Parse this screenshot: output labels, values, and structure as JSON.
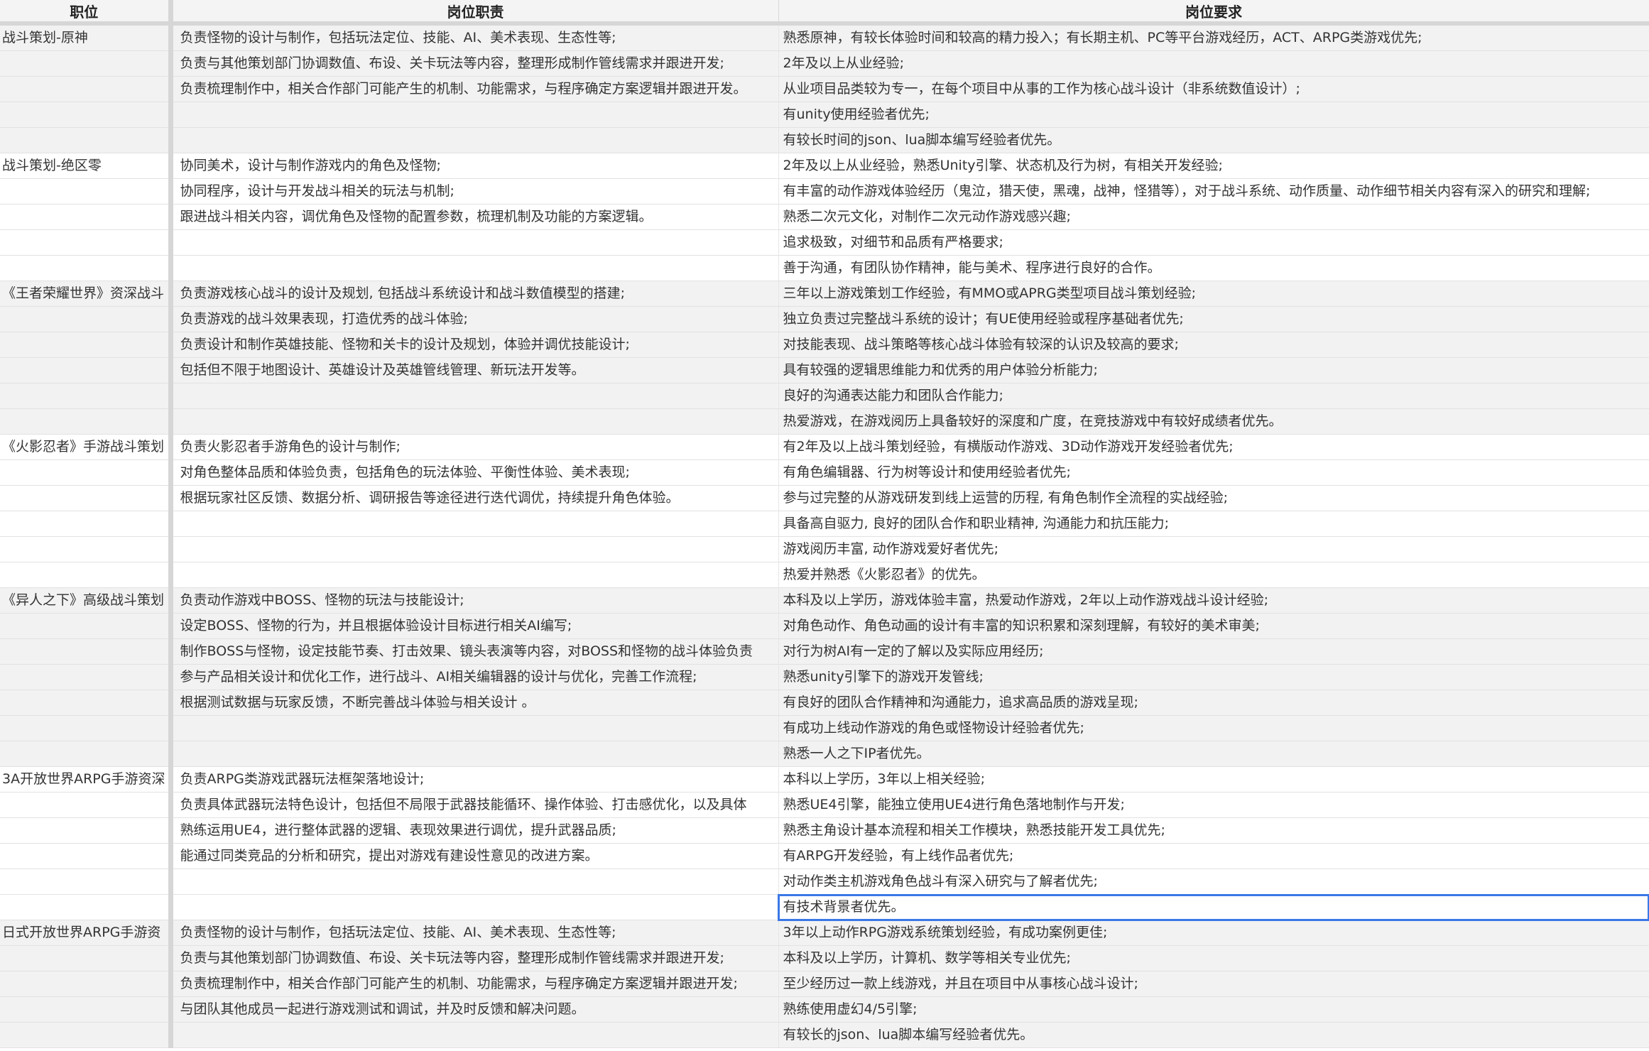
{
  "header": {
    "position": "职位",
    "duty": "岗位职责",
    "requirement": "岗位要求"
  },
  "selected_row": 34,
  "rows": [
    {
      "position": "战斗策划-原神",
      "duty": "负责怪物的设计与制作，包括玩法定位、技能、AI、美术表现、生态性等;",
      "requirement": "熟悉原神，有较长体验时间和较高的精力投入；有长期主机、PC等平台游戏经历，ACT、ARPG类游戏优先;"
    },
    {
      "position": "",
      "duty": "负责与其他策划部门协调数值、布设、关卡玩法等内容，整理形成制作管线需求并跟进开发;",
      "requirement": "2年及以上从业经验;"
    },
    {
      "position": "",
      "duty": "负责梳理制作中，相关合作部门可能产生的机制、功能需求，与程序确定方案逻辑并跟进开发。",
      "requirement": "从业项目品类较为专一，在每个项目中从事的工作为核心战斗设计（非系统数值设计）;"
    },
    {
      "position": "",
      "duty": "",
      "requirement": "有unity使用经验者优先;"
    },
    {
      "position": "",
      "duty": "",
      "requirement": "有较长时间的json、lua脚本编写经验者优先。"
    },
    {
      "position": "战斗策划-绝区零",
      "duty": "协同美术，设计与制作游戏内的角色及怪物;",
      "requirement": "2年及以上从业经验，熟悉Unity引擎、状态机及行为树，有相关开发经验;"
    },
    {
      "position": "",
      "duty": "协同程序，设计与开发战斗相关的玩法与机制;",
      "requirement": "有丰富的动作游戏体验经历（鬼泣，猎天使，黑魂，战神，怪猎等），对于战斗系统、动作质量、动作细节相关内容有深入的研究和理解;"
    },
    {
      "position": "",
      "duty": "跟进战斗相关内容，调优角色及怪物的配置参数，梳理机制及功能的方案逻辑。",
      "requirement": "熟悉二次元文化，对制作二次元动作游戏感兴趣;"
    },
    {
      "position": "",
      "duty": "",
      "requirement": "追求极致，对细节和品质有严格要求;"
    },
    {
      "position": "",
      "duty": "",
      "requirement": "善于沟通，有团队协作精神，能与美术、程序进行良好的合作。"
    },
    {
      "position": "《王者荣耀世界》资深战斗",
      "duty": "负责游戏核心战斗的设计及规划, 包括战斗系统设计和战斗数值模型的搭建;",
      "requirement": "三年以上游戏策划工作经验，有MMO或APRG类型项目战斗策划经验;"
    },
    {
      "position": "",
      "duty": "负责游戏的战斗效果表现，打造优秀的战斗体验;",
      "requirement": "独立负责过完整战斗系统的设计；有UE使用经验或程序基础者优先;"
    },
    {
      "position": "",
      "duty": "负责设计和制作英雄技能、怪物和关卡的设计及规划，体验并调优技能设计;",
      "requirement": "对技能表现、战斗策略等核心战斗体验有较深的认识及较高的要求;"
    },
    {
      "position": "",
      "duty": "包括但不限于地图设计、英雄设计及英雄管线管理、新玩法开发等。",
      "requirement": "具有较强的逻辑思维能力和优秀的用户体验分析能力;"
    },
    {
      "position": "",
      "duty": "",
      "requirement": "良好的沟通表达能力和团队合作能力;"
    },
    {
      "position": "",
      "duty": "",
      "requirement": "热爱游戏，在游戏阅历上具备较好的深度和广度，在竞技游戏中有较好成绩者优先。"
    },
    {
      "position": "《火影忍者》手游战斗策划",
      "duty": "负责火影忍者手游角色的设计与制作;",
      "requirement": "有2年及以上战斗策划经验，有横版动作游戏、3D动作游戏开发经验者优先;"
    },
    {
      "position": "",
      "duty": "对角色整体品质和体验负责，包括角色的玩法体验、平衡性体验、美术表现;",
      "requirement": "有角色编辑器、行为树等设计和使用经验者优先;"
    },
    {
      "position": "",
      "duty": "根据玩家社区反馈、数据分析、调研报告等途径进行迭代调优，持续提升角色体验。",
      "requirement": "参与过完整的从游戏研发到线上运营的历程, 有角色制作全流程的实战经验;"
    },
    {
      "position": "",
      "duty": "",
      "requirement": "具备高自驱力, 良好的团队合作和职业精神, 沟通能力和抗压能力;"
    },
    {
      "position": "",
      "duty": "",
      "requirement": "游戏阅历丰富, 动作游戏爱好者优先;"
    },
    {
      "position": "",
      "duty": "",
      "requirement": "热爱并熟悉《火影忍者》的优先。"
    },
    {
      "position": "《异人之下》高级战斗策划",
      "duty": "负责动作游戏中BOSS、怪物的玩法与技能设计;",
      "requirement": "本科及以上学历，游戏体验丰富，热爱动作游戏，2年以上动作游戏战斗设计经验;"
    },
    {
      "position": "",
      "duty": "设定BOSS、怪物的行为，并且根据体验设计目标进行相关AI编写;",
      "requirement": "对角色动作、角色动画的设计有丰富的知识积累和深刻理解，有较好的美术审美;"
    },
    {
      "position": "",
      "duty": "制作BOSS与怪物，设定技能节奏、打击效果、镜头表演等内容，对BOSS和怪物的战斗体验负责",
      "requirement": "对行为树AI有一定的了解以及实际应用经历;"
    },
    {
      "position": "",
      "duty": "参与产品相关设计和优化工作，进行战斗、AI相关编辑器的设计与优化，完善工作流程;",
      "requirement": "熟悉unity引擎下的游戏开发管线;"
    },
    {
      "position": "",
      "duty": "根据测试数据与玩家反馈，不断完善战斗体验与相关设计 。",
      "requirement": "有良好的团队合作精神和沟通能力，追求高品质的游戏呈现;"
    },
    {
      "position": "",
      "duty": "",
      "requirement": "有成功上线动作游戏的角色或怪物设计经验者优先;"
    },
    {
      "position": "",
      "duty": "",
      "requirement": "熟悉一人之下IP者优先。"
    },
    {
      "position": "3A开放世界ARPG手游资深",
      "duty": "负责ARPG类游戏武器玩法框架落地设计;",
      "requirement": "本科以上学历，3年以上相关经验;"
    },
    {
      "position": "",
      "duty": "负责具体武器玩法特色设计，包括但不局限于武器技能循环、操作体验、打击感优化，以及具体",
      "requirement": "熟悉UE4引擎，能独立使用UE4进行角色落地制作与开发;"
    },
    {
      "position": "",
      "duty": "熟练运用UE4，进行整体武器的逻辑、表现效果进行调优，提升武器品质;",
      "requirement": "熟悉主角设计基本流程和相关工作模块，熟悉技能开发工具优先;"
    },
    {
      "position": "",
      "duty": "能通过同类竞品的分析和研究，提出对游戏有建设性意见的改进方案。",
      "requirement": "有ARPG开发经验，有上线作品者优先;"
    },
    {
      "position": "",
      "duty": "",
      "requirement": "对动作类主机游戏角色战斗有深入研究与了解者优先;"
    },
    {
      "position": "",
      "duty": "",
      "requirement": "有技术背景者优先。"
    },
    {
      "position": "日式开放世界ARPG手游资",
      "duty": "负责怪物的设计与制作，包括玩法定位、技能、AI、美术表现、生态性等;",
      "requirement": "3年以上动作RPG游戏系统策划经验，有成功案例更佳;"
    },
    {
      "position": "",
      "duty": "负责与其他策划部门协调数值、布设、关卡玩法等内容，整理形成制作管线需求并跟进开发;",
      "requirement": "本科及以上学历，计算机、数学等相关专业优先;"
    },
    {
      "position": "",
      "duty": "负责梳理制作中，相关合作部门可能产生的机制、功能需求，与程序确定方案逻辑并跟进开发;",
      "requirement": "至少经历过一款上线游戏，并且在项目中从事核心战斗设计;"
    },
    {
      "position": "",
      "duty": "与团队其他成员一起进行游戏测试和调试，并及时反馈和解决问题。",
      "requirement": "熟练使用虚幻4/5引擎;"
    },
    {
      "position": "",
      "duty": "",
      "requirement": "有较长的json、lua脚本编写经验者优先。"
    }
  ]
}
